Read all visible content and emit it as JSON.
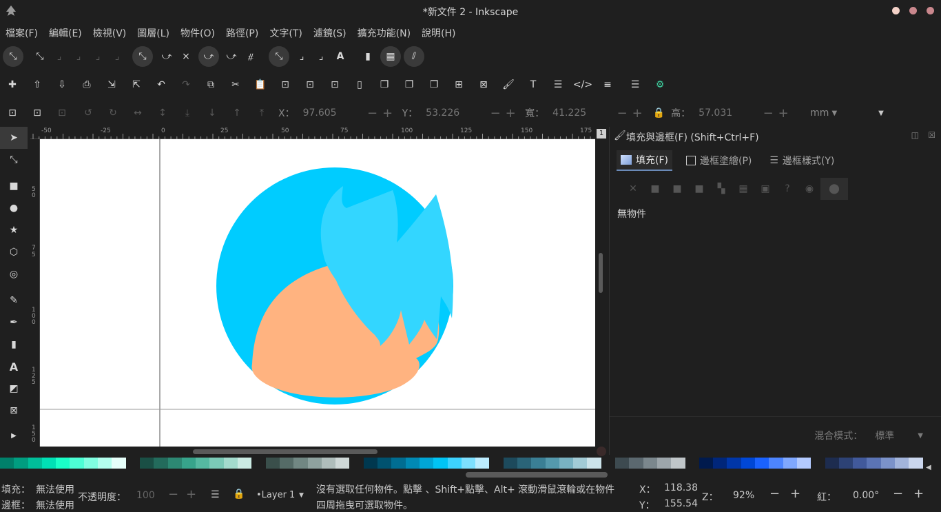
{
  "window": {
    "title": "*新文件 2 - Inkscape",
    "controls": [
      {
        "name": "minimize-button",
        "color": "#f4d2c8"
      },
      {
        "name": "maximize-button",
        "color": "#c9878d"
      },
      {
        "name": "close-button",
        "color": "#c9878d"
      }
    ]
  },
  "menu": [
    "檔案(F)",
    "編輯(E)",
    "檢視(V)",
    "圖層(L)",
    "物件(O)",
    "路徑(P)",
    "文字(T)",
    "濾鏡(S)",
    "擴充功能(N)",
    "說明(H)"
  ],
  "control_bar": {
    "x_label": "X：",
    "x_value": "97.605",
    "y_label": "Y：",
    "y_value": "53.226",
    "w_label": "寬：",
    "w_value": "41.225",
    "h_label": "高：",
    "h_value": "57.031",
    "unit": "mm"
  },
  "rulers": {
    "h_ticks": [
      "-50",
      "-25",
      "0",
      "25",
      "50",
      "75",
      "100",
      "125",
      "150",
      "175"
    ],
    "v_ticks": [
      "5",
      "0",
      "7",
      "5",
      "1",
      "0",
      "0",
      "1",
      "2",
      "5",
      "1",
      "5",
      "0"
    ]
  },
  "dock": {
    "title": "填充與邊框(F) (Shift+Ctrl+F)",
    "tabs": [
      "填充(F)",
      "邊框塗繪(P)",
      "邊框樣式(Y)"
    ],
    "no_object": "無物件",
    "blend_label": "混合模式：",
    "blend_value": "標準"
  },
  "status": {
    "fill_label": "填充：",
    "fill_value": "無法使用",
    "stroke_label": "邊框：",
    "stroke_value": "無法使用",
    "opacity_label": "不透明度：",
    "opacity_value": "100",
    "layer": "•Layer 1",
    "message_line1": "沒有選取任何物件。點擊 、Shift+點擊、Alt+ 滾動滑鼠滾輪或在物件",
    "message_line2": "四周拖曳可選取物件。",
    "cursor_x_label": "X：",
    "cursor_x": "118.38",
    "cursor_y_label": "Y：",
    "cursor_y": "155.54",
    "zoom_label": "Z：",
    "zoom": "92%",
    "rotate_label": "紅：",
    "rotate": "0.00°"
  },
  "colors": {
    "hair": "#00ccff",
    "hair_light": "#33d6ff",
    "skin": "#ffb380",
    "canvas": "#ffffff",
    "background": "#1f1f1f"
  }
}
